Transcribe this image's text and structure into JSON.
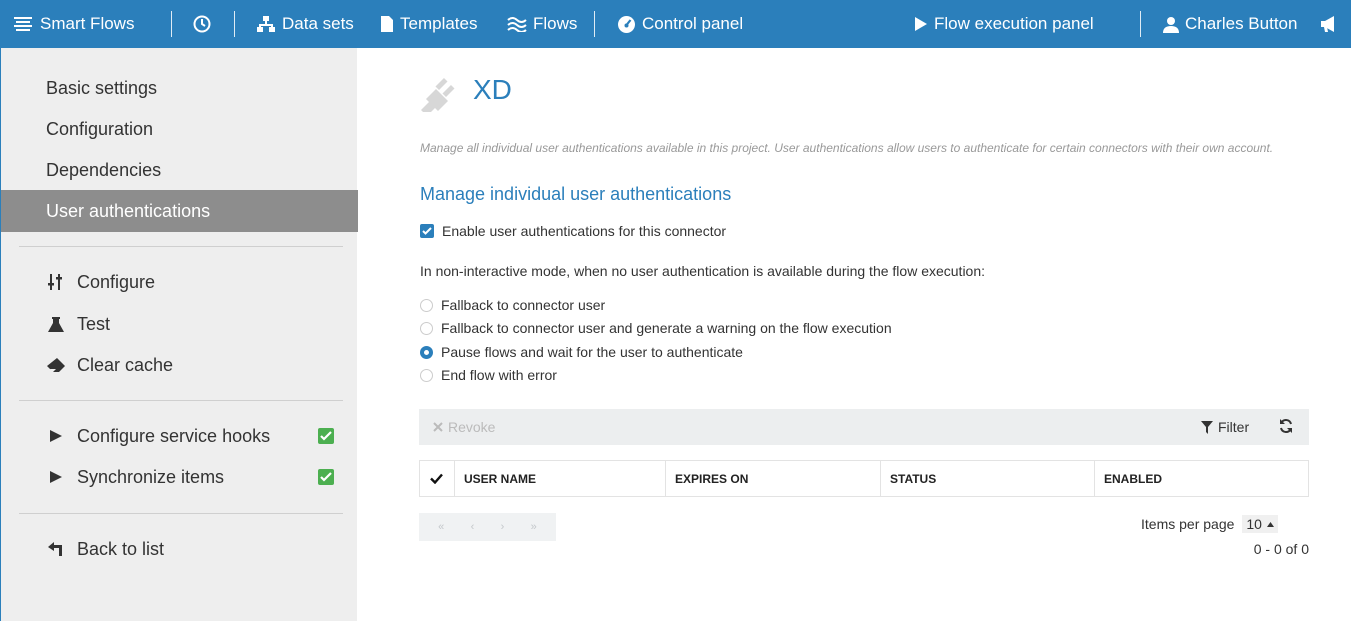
{
  "topbar": {
    "brand": "Smart Flows",
    "datasets": "Data sets",
    "templates": "Templates",
    "flows": "Flows",
    "control_panel": "Control panel",
    "flow_execution_panel": "Flow execution panel",
    "user": "Charles Button"
  },
  "sidebar": {
    "basic_settings": "Basic settings",
    "configuration": "Configuration",
    "dependencies": "Dependencies",
    "user_authentications": "User authentications",
    "configure": "Configure",
    "test": "Test",
    "clear_cache": "Clear cache",
    "configure_service_hooks": "Configure service hooks",
    "synchronize_items": "Synchronize items",
    "back_to_list": "Back to list"
  },
  "main": {
    "title": "XD",
    "description": "Manage all individual user authentications available in this project. User authentications allow users to authenticate for certain connectors with their own account.",
    "subheading": "Manage individual user authentications",
    "enable_label": "Enable user authentications for this connector",
    "mode_label": "In non-interactive mode, when no user authentication is available during the flow execution:",
    "options": [
      "Fallback to connector user",
      "Fallback to connector user and generate a warning on the flow execution",
      "Pause flows and wait for the user to authenticate",
      "End flow with error"
    ],
    "selected_option_index": 2,
    "revoke_label": "Revoke",
    "filter_label": "Filter",
    "columns": [
      "USER NAME",
      "EXPIRES ON",
      "STATUS",
      "ENABLED"
    ],
    "pager": [
      "«",
      "‹",
      "›",
      "»"
    ],
    "items_per_page_label": "Items per page",
    "items_per_page_value": "10",
    "range_text": "0 - 0 of 0"
  },
  "colors": {
    "accent": "#2b7fbb",
    "active_sidebar": "#8d8d8d",
    "check_green": "#4caf50"
  }
}
